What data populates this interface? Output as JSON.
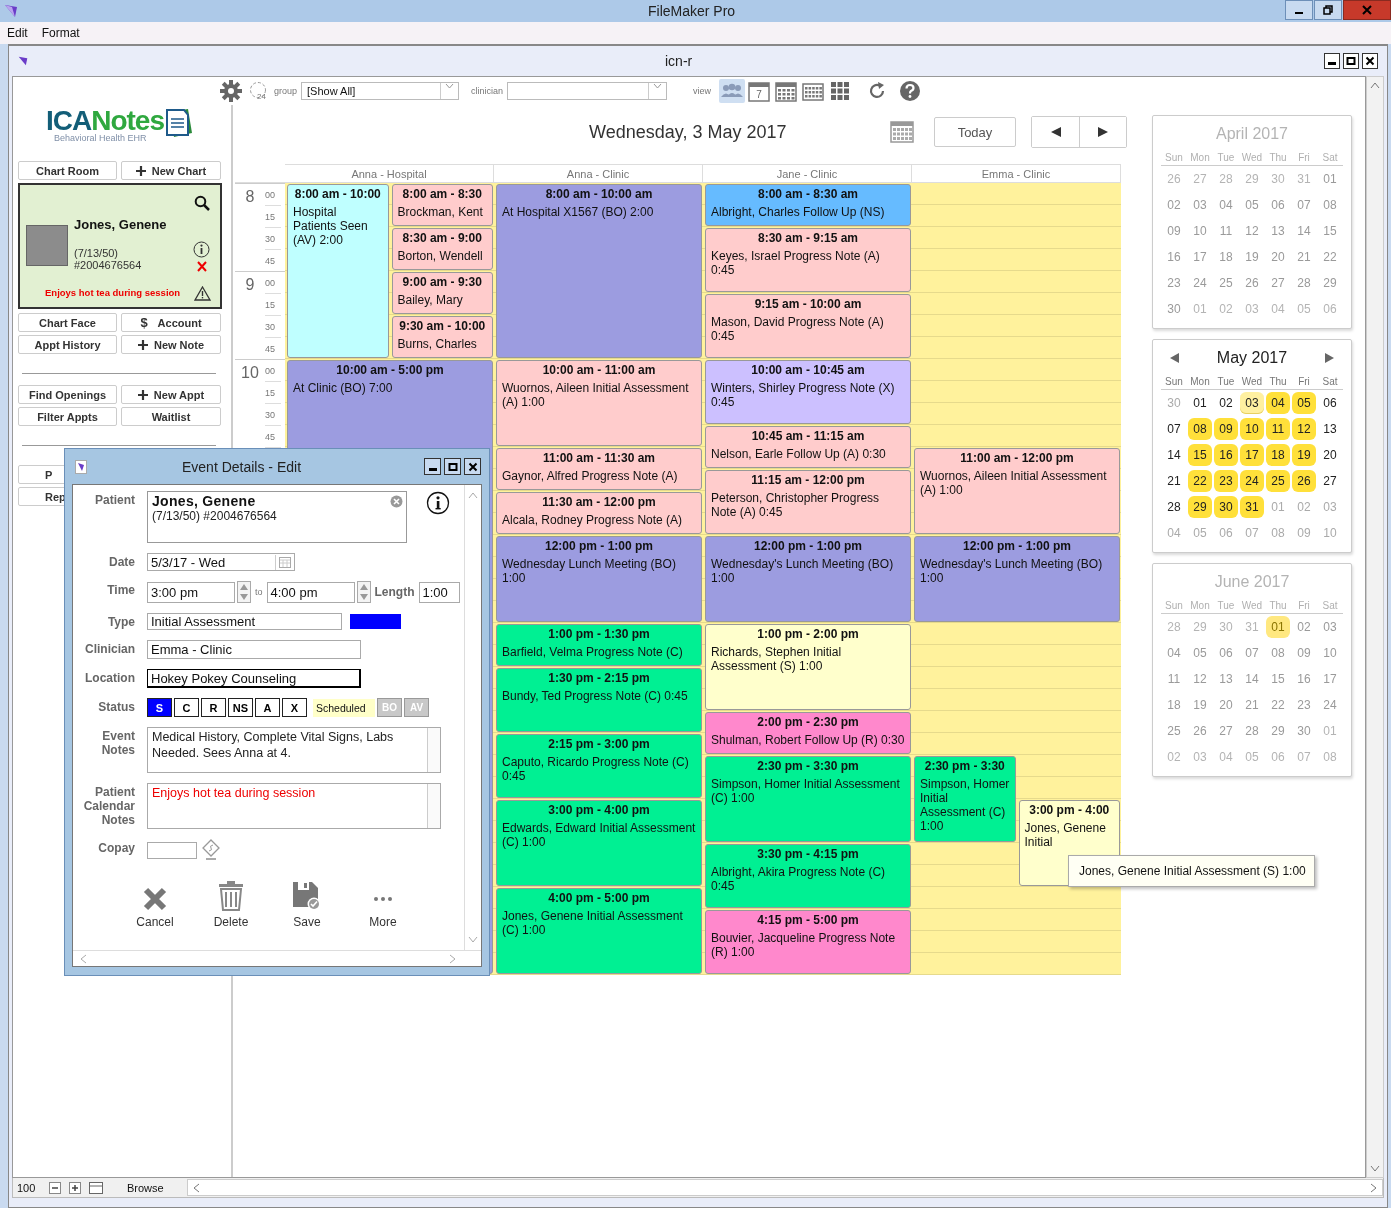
{
  "app_title": "FileMaker Pro",
  "menu": [
    "Edit",
    "Format"
  ],
  "window_title": "icn-r",
  "toolbar": {
    "history_label": "24",
    "group_label": "group",
    "group_value": "[Show All]",
    "clinician_label": "clinician",
    "view_label": "view",
    "views": [
      {
        "kind": "people",
        "selected": true
      },
      {
        "kind": "day",
        "label": "7",
        "selected": false
      },
      {
        "kind": "week",
        "selected": false
      },
      {
        "kind": "month",
        "selected": false
      },
      {
        "kind": "grid",
        "selected": false
      }
    ]
  },
  "sidebar": {
    "logo": {
      "part1": "ICA",
      "part2": "Notes",
      "tagline": "Behavioral Health EHR"
    },
    "top_buttons": [
      {
        "label": "Chart Room",
        "kind": "plain"
      },
      {
        "label": "New Chart",
        "kind": "add"
      }
    ],
    "patient": {
      "name": "Jones, Genene",
      "dob": "(7/13/50)",
      "number": "#2004676564",
      "note": "Enjoys hot tea during session"
    },
    "chart_buttons": [
      {
        "label": "Chart Face",
        "kind": "plain"
      },
      {
        "label": "Account",
        "kind": "money",
        "glyph": "$"
      },
      {
        "label": "Appt History",
        "kind": "plain"
      },
      {
        "label": "New Note",
        "kind": "add"
      }
    ],
    "appt_buttons": [
      {
        "label": "Find Openings",
        "kind": "plain"
      },
      {
        "label": "New Appt",
        "kind": "add"
      },
      {
        "label": "Filter Appts",
        "kind": "plain"
      },
      {
        "label": "Waitlist",
        "kind": "plain"
      }
    ],
    "other_buttons": [
      {
        "label": "P"
      },
      {
        "label": "Rep"
      }
    ]
  },
  "calendar": {
    "date_title": "Wednesday, 3 May 2017",
    "today": "Today",
    "hours": [
      {
        "hour": "8",
        "minutes": [
          "00",
          "15",
          "30",
          "45"
        ]
      },
      {
        "hour": "9",
        "minutes": [
          "00",
          "15",
          "30",
          "45"
        ]
      },
      {
        "hour": "10",
        "minutes": [
          "00",
          "15",
          "30",
          "45"
        ]
      }
    ],
    "columns": [
      {
        "header": "Anna - Hospital",
        "events": [
          {
            "time": "8:00 am - 10:00",
            "text": "Hospital Patients Seen (AV) 2:00",
            "color": "#bfffff"
          },
          {
            "time": "8:00 am - 8:30",
            "text": "Brockman, Kent",
            "color": "#ffcccc"
          },
          {
            "time": "8:30 am - 9:00",
            "text": "Borton, Wendell",
            "color": "#ffcccc"
          },
          {
            "time": "9:00 am - 9:30",
            "text": "Bailey, Mary",
            "color": "#ffcccc"
          },
          {
            "time": "9:30 am - 10:00",
            "text": "Burns, Charles",
            "color": "#ffcccc"
          },
          {
            "time": "10:00 am - 5:00 pm",
            "text": "At Clinic (BO) 7:00",
            "color": "#9c9ce0"
          }
        ]
      },
      {
        "header": "Anna - Clinic",
        "events": [
          {
            "time": "8:00 am - 10:00 am",
            "text": "At Hospital X1567 (BO) 2:00",
            "color": "#9c9ce0"
          },
          {
            "time": "10:00 am - 11:00 am",
            "text": "Wuornos, Aileen Initial Assessment (A) 1:00",
            "color": "#ffcccc"
          },
          {
            "time": "11:00 am - 11:30 am",
            "text": "Gaynor, Alfred Progress Note (A)",
            "color": "#ffcccc"
          },
          {
            "time": "11:30 am - 12:00 pm",
            "text": "Alcala, Rodney Progress Note (A)",
            "color": "#ffcccc"
          },
          {
            "time": "12:00 pm - 1:00 pm",
            "text": "Wednesday Lunch Meeting (BO) 1:00",
            "color": "#9c9ce0"
          },
          {
            "time": "1:00 pm - 1:30 pm",
            "text": "Barfield, Velma Progress Note (C)",
            "color": "#00f093"
          },
          {
            "time": "1:30 pm - 2:15 pm",
            "text": "Bundy, Ted Progress Note (C) 0:45",
            "color": "#00f093"
          },
          {
            "time": "2:15 pm - 3:00 pm",
            "text": "Caputo, Ricardo Progress Note (C) 0:45",
            "color": "#00f093"
          },
          {
            "time": "3:00 pm - 4:00 pm",
            "text": "Edwards, Edward Initial Assessment (C) 1:00",
            "color": "#00f093"
          },
          {
            "time": "4:00 pm - 5:00 pm",
            "text": "Jones, Genene Initial Assessment (C) 1:00",
            "color": "#00f093"
          }
        ]
      },
      {
        "header": "Jane - Clinic",
        "events": [
          {
            "time": "8:00 am - 8:30 am",
            "text": "Albright, Charles Follow Up (NS)",
            "color": "#66bbff"
          },
          {
            "time": "8:30 am - 9:15 am",
            "text": "Keyes, Israel Progress Note (A) 0:45",
            "color": "#ffcccc"
          },
          {
            "time": "9:15 am - 10:00 am",
            "text": "Mason, David Progress Note (A) 0:45",
            "color": "#ffcccc"
          },
          {
            "time": "10:00 am - 10:45 am",
            "text": "Winters, Shirley Progress Note (X) 0:45",
            "color": "#ccc0ff"
          },
          {
            "time": "10:45 am - 11:15 am",
            "text": "Nelson, Earle Follow Up (A) 0:30",
            "color": "#ffcccc"
          },
          {
            "time": "11:15 am - 12:00 pm",
            "text": "Peterson, Christopher Progress Note (A) 0:45",
            "color": "#ffcccc"
          },
          {
            "time": "12:00 pm - 1:00 pm",
            "text": "Wednesday's Lunch Meeting (BO) 1:00",
            "color": "#9c9ce0"
          },
          {
            "time": "1:00 pm - 2:00 pm",
            "text": "Richards, Stephen Initial Assessment (S) 1:00",
            "color": "#ffffcc"
          },
          {
            "time": "2:00 pm - 2:30 pm",
            "text": "Shulman, Robert Follow Up (R) 0:30",
            "color": "#ff88cc"
          },
          {
            "time": "2:30 pm - 3:30 pm",
            "text": "Simpson, Homer Initial Assessment (C) 1:00",
            "color": "#00f093"
          },
          {
            "time": "3:30 pm - 4:15 pm",
            "text": "Albright, Akira Progress Note (C) 0:45",
            "color": "#00f093"
          },
          {
            "time": "4:15 pm - 5:00 pm",
            "text": "Bouvier, Jacqueline Progress Note (R) 1:00",
            "color": "#ff88cc"
          }
        ]
      },
      {
        "header": "Emma - Clinic",
        "events": [
          {
            "time": "11:00 am - 12:00 pm",
            "text": "Wuornos, Aileen Initial Assessment (A) 1:00",
            "color": "#ffcccc"
          },
          {
            "time": "12:00 pm - 1:00 pm",
            "text": "Wednesday's Lunch Meeting (BO) 1:00",
            "color": "#9c9ce0"
          },
          {
            "time": "2:30 pm - 3:30",
            "text": "Simpson, Homer Initial Assessment (C) 1:00",
            "color": "#00f093"
          },
          {
            "time": "3:00 pm - 4:00",
            "text": "Jones, Genene Initial",
            "color": "#ffffcc"
          }
        ]
      }
    ]
  },
  "tooltip": "Jones, Genene Initial Assessment (S) 1:00",
  "minicals": [
    {
      "title": "April 2017",
      "active": false,
      "weekdays": [
        "Sun",
        "Mon",
        "Tue",
        "Wed",
        "Thu",
        "Fri",
        "Sat"
      ],
      "weeks": [
        [
          {
            "day": "26",
            "in_month": false,
            "booked": false,
            "selected": false
          },
          {
            "day": "27",
            "in_month": false,
            "booked": false,
            "selected": false
          },
          {
            "day": "28",
            "in_month": false,
            "booked": false,
            "selected": false
          },
          {
            "day": "29",
            "in_month": false,
            "booked": false,
            "selected": false
          },
          {
            "day": "30",
            "in_month": false,
            "booked": false,
            "selected": false
          },
          {
            "day": "31",
            "in_month": false,
            "booked": false,
            "selected": false
          },
          {
            "day": "01",
            "in_month": true,
            "booked": false,
            "selected": false
          }
        ],
        [
          {
            "day": "02",
            "in_month": true,
            "booked": false,
            "selected": false
          },
          {
            "day": "03",
            "in_month": true,
            "booked": false,
            "selected": false
          },
          {
            "day": "04",
            "in_month": true,
            "booked": false,
            "selected": false
          },
          {
            "day": "05",
            "in_month": true,
            "booked": false,
            "selected": false
          },
          {
            "day": "06",
            "in_month": true,
            "booked": false,
            "selected": false
          },
          {
            "day": "07",
            "in_month": true,
            "booked": false,
            "selected": false
          },
          {
            "day": "08",
            "in_month": true,
            "booked": false,
            "selected": false
          }
        ],
        [
          {
            "day": "09",
            "in_month": true,
            "booked": false,
            "selected": false
          },
          {
            "day": "10",
            "in_month": true,
            "booked": false,
            "selected": false
          },
          {
            "day": "11",
            "in_month": true,
            "booked": false,
            "selected": false
          },
          {
            "day": "12",
            "in_month": true,
            "booked": false,
            "selected": false
          },
          {
            "day": "13",
            "in_month": true,
            "booked": false,
            "selected": false
          },
          {
            "day": "14",
            "in_month": true,
            "booked": false,
            "selected": false
          },
          {
            "day": "15",
            "in_month": true,
            "booked": false,
            "selected": false
          }
        ],
        [
          {
            "day": "16",
            "in_month": true,
            "booked": false,
            "selected": false
          },
          {
            "day": "17",
            "in_month": true,
            "booked": false,
            "selected": false
          },
          {
            "day": "18",
            "in_month": true,
            "booked": false,
            "selected": false
          },
          {
            "day": "19",
            "in_month": true,
            "booked": false,
            "selected": false
          },
          {
            "day": "20",
            "in_month": true,
            "booked": false,
            "selected": false
          },
          {
            "day": "21",
            "in_month": true,
            "booked": false,
            "selected": false
          },
          {
            "day": "22",
            "in_month": true,
            "booked": false,
            "selected": false
          }
        ],
        [
          {
            "day": "23",
            "in_month": true,
            "booked": false,
            "selected": false
          },
          {
            "day": "24",
            "in_month": true,
            "booked": false,
            "selected": false
          },
          {
            "day": "25",
            "in_month": true,
            "booked": false,
            "selected": false
          },
          {
            "day": "26",
            "in_month": true,
            "booked": false,
            "selected": false
          },
          {
            "day": "27",
            "in_month": true,
            "booked": false,
            "selected": false
          },
          {
            "day": "28",
            "in_month": true,
            "booked": false,
            "selected": false
          },
          {
            "day": "29",
            "in_month": true,
            "booked": false,
            "selected": false
          }
        ],
        [
          {
            "day": "30",
            "in_month": true,
            "booked": false,
            "selected": false
          },
          {
            "day": "01",
            "in_month": false,
            "booked": false,
            "selected": false
          },
          {
            "day": "02",
            "in_month": false,
            "booked": false,
            "selected": false
          },
          {
            "day": "03",
            "in_month": false,
            "booked": false,
            "selected": false
          },
          {
            "day": "04",
            "in_month": false,
            "booked": false,
            "selected": false
          },
          {
            "day": "05",
            "in_month": false,
            "booked": false,
            "selected": false
          },
          {
            "day": "06",
            "in_month": false,
            "booked": false,
            "selected": false
          }
        ]
      ]
    },
    {
      "title": "May 2017",
      "active": true,
      "weekdays": [
        "Sun",
        "Mon",
        "Tue",
        "Wed",
        "Thu",
        "Fri",
        "Sat"
      ],
      "weeks": [
        [
          {
            "day": "30",
            "in_month": false,
            "booked": false,
            "selected": false
          },
          {
            "day": "01",
            "in_month": true,
            "booked": false,
            "selected": false
          },
          {
            "day": "02",
            "in_month": true,
            "booked": false,
            "selected": false
          },
          {
            "day": "03",
            "in_month": true,
            "booked": false,
            "selected": true
          },
          {
            "day": "04",
            "in_month": true,
            "booked": true,
            "selected": false
          },
          {
            "day": "05",
            "in_month": true,
            "booked": true,
            "selected": false
          },
          {
            "day": "06",
            "in_month": true,
            "booked": false,
            "selected": false
          }
        ],
        [
          {
            "day": "07",
            "in_month": true,
            "booked": false,
            "selected": false
          },
          {
            "day": "08",
            "in_month": true,
            "booked": true,
            "selected": false
          },
          {
            "day": "09",
            "in_month": true,
            "booked": true,
            "selected": false
          },
          {
            "day": "10",
            "in_month": true,
            "booked": true,
            "selected": false
          },
          {
            "day": "11",
            "in_month": true,
            "booked": true,
            "selected": false
          },
          {
            "day": "12",
            "in_month": true,
            "booked": true,
            "selected": false
          },
          {
            "day": "13",
            "in_month": true,
            "booked": false,
            "selected": false
          }
        ],
        [
          {
            "day": "14",
            "in_month": true,
            "booked": false,
            "selected": false
          },
          {
            "day": "15",
            "in_month": true,
            "booked": true,
            "selected": false
          },
          {
            "day": "16",
            "in_month": true,
            "booked": true,
            "selected": false
          },
          {
            "day": "17",
            "in_month": true,
            "booked": true,
            "selected": false
          },
          {
            "day": "18",
            "in_month": true,
            "booked": true,
            "selected": false
          },
          {
            "day": "19",
            "in_month": true,
            "booked": true,
            "selected": false
          },
          {
            "day": "20",
            "in_month": true,
            "booked": false,
            "selected": false
          }
        ],
        [
          {
            "day": "21",
            "in_month": true,
            "booked": false,
            "selected": false
          },
          {
            "day": "22",
            "in_month": true,
            "booked": true,
            "selected": false
          },
          {
            "day": "23",
            "in_month": true,
            "booked": true,
            "selected": false
          },
          {
            "day": "24",
            "in_month": true,
            "booked": true,
            "selected": false
          },
          {
            "day": "25",
            "in_month": true,
            "booked": true,
            "selected": false
          },
          {
            "day": "26",
            "in_month": true,
            "booked": true,
            "selected": false
          },
          {
            "day": "27",
            "in_month": true,
            "booked": false,
            "selected": false
          }
        ],
        [
          {
            "day": "28",
            "in_month": true,
            "booked": false,
            "selected": false
          },
          {
            "day": "29",
            "in_month": true,
            "booked": true,
            "selected": false
          },
          {
            "day": "30",
            "in_month": true,
            "booked": true,
            "selected": false
          },
          {
            "day": "31",
            "in_month": true,
            "booked": true,
            "selected": false
          },
          {
            "day": "01",
            "in_month": false,
            "booked": false,
            "selected": false
          },
          {
            "day": "02",
            "in_month": false,
            "booked": false,
            "selected": false
          },
          {
            "day": "03",
            "in_month": false,
            "booked": false,
            "selected": false
          }
        ],
        [
          {
            "day": "04",
            "in_month": false,
            "booked": false,
            "selected": false
          },
          {
            "day": "05",
            "in_month": false,
            "booked": false,
            "selected": false
          },
          {
            "day": "06",
            "in_month": false,
            "booked": false,
            "selected": false
          },
          {
            "day": "07",
            "in_month": false,
            "booked": false,
            "selected": false
          },
          {
            "day": "08",
            "in_month": false,
            "booked": false,
            "selected": false
          },
          {
            "day": "09",
            "in_month": false,
            "booked": false,
            "selected": false
          },
          {
            "day": "10",
            "in_month": false,
            "booked": false,
            "selected": false
          }
        ]
      ]
    },
    {
      "title": "June 2017",
      "active": false,
      "weekdays": [
        "Sun",
        "Mon",
        "Tue",
        "Wed",
        "Thu",
        "Fri",
        "Sat"
      ],
      "weeks": [
        [
          {
            "day": "28",
            "in_month": false,
            "booked": false,
            "selected": false
          },
          {
            "day": "29",
            "in_month": false,
            "booked": false,
            "selected": false
          },
          {
            "day": "30",
            "in_month": false,
            "booked": false,
            "selected": false
          },
          {
            "day": "31",
            "in_month": false,
            "booked": false,
            "selected": false
          },
          {
            "day": "01",
            "in_month": true,
            "booked": true,
            "selected": false
          },
          {
            "day": "02",
            "in_month": true,
            "booked": false,
            "selected": false
          },
          {
            "day": "03",
            "in_month": true,
            "booked": false,
            "selected": false
          }
        ],
        [
          {
            "day": "04",
            "in_month": true,
            "booked": false,
            "selected": false
          },
          {
            "day": "05",
            "in_month": true,
            "booked": false,
            "selected": false
          },
          {
            "day": "06",
            "in_month": true,
            "booked": false,
            "selected": false
          },
          {
            "day": "07",
            "in_month": true,
            "booked": false,
            "selected": false
          },
          {
            "day": "08",
            "in_month": true,
            "booked": false,
            "selected": false
          },
          {
            "day": "09",
            "in_month": true,
            "booked": false,
            "selected": false
          },
          {
            "day": "10",
            "in_month": true,
            "booked": false,
            "selected": false
          }
        ],
        [
          {
            "day": "11",
            "in_month": true,
            "booked": false,
            "selected": false
          },
          {
            "day": "12",
            "in_month": true,
            "booked": false,
            "selected": false
          },
          {
            "day": "13",
            "in_month": true,
            "booked": false,
            "selected": false
          },
          {
            "day": "14",
            "in_month": true,
            "booked": false,
            "selected": false
          },
          {
            "day": "15",
            "in_month": true,
            "booked": false,
            "selected": false
          },
          {
            "day": "16",
            "in_month": true,
            "booked": false,
            "selected": false
          },
          {
            "day": "17",
            "in_month": true,
            "booked": false,
            "selected": false
          }
        ],
        [
          {
            "day": "18",
            "in_month": true,
            "booked": false,
            "selected": false
          },
          {
            "day": "19",
            "in_month": true,
            "booked": false,
            "selected": false
          },
          {
            "day": "20",
            "in_month": true,
            "booked": false,
            "selected": false
          },
          {
            "day": "21",
            "in_month": true,
            "booked": false,
            "selected": false
          },
          {
            "day": "22",
            "in_month": true,
            "booked": false,
            "selected": false
          },
          {
            "day": "23",
            "in_month": true,
            "booked": false,
            "selected": false
          },
          {
            "day": "24",
            "in_month": true,
            "booked": false,
            "selected": false
          }
        ],
        [
          {
            "day": "25",
            "in_month": true,
            "booked": false,
            "selected": false
          },
          {
            "day": "26",
            "in_month": true,
            "booked": false,
            "selected": false
          },
          {
            "day": "27",
            "in_month": true,
            "booked": false,
            "selected": false
          },
          {
            "day": "28",
            "in_month": true,
            "booked": false,
            "selected": false
          },
          {
            "day": "29",
            "in_month": true,
            "booked": false,
            "selected": false
          },
          {
            "day": "30",
            "in_month": true,
            "booked": false,
            "selected": false
          },
          {
            "day": "01",
            "in_month": false,
            "booked": false,
            "selected": false
          }
        ],
        [
          {
            "day": "02",
            "in_month": false,
            "booked": false,
            "selected": false
          },
          {
            "day": "03",
            "in_month": false,
            "booked": false,
            "selected": false
          },
          {
            "day": "04",
            "in_month": false,
            "booked": false,
            "selected": false
          },
          {
            "day": "05",
            "in_month": false,
            "booked": false,
            "selected": false
          },
          {
            "day": "06",
            "in_month": false,
            "booked": false,
            "selected": false
          },
          {
            "day": "07",
            "in_month": false,
            "booked": false,
            "selected": false
          },
          {
            "day": "08",
            "in_month": false,
            "booked": false,
            "selected": false
          }
        ]
      ]
    }
  ],
  "dialog": {
    "title": "Event Details - Edit",
    "labels": {
      "patient": "Patient",
      "date": "Date",
      "time": "Time",
      "type": "Type",
      "clinician": "Clinician",
      "location": "Location",
      "status": "Status",
      "event_notes": "Event Notes",
      "calendar_notes": "Patient Calendar Notes",
      "copay": "Copay"
    },
    "patient_name": "Jones, Genene",
    "patient_info": "(7/13/50) #2004676564",
    "date": "5/3/17 - Wed",
    "time_from": "3:00 pm",
    "to_label": "to",
    "time_to": "4:00 pm",
    "length_label": "Length",
    "length": "1:00",
    "type": {
      "label": "Initial Assessment",
      "color": "#0000ff"
    },
    "clinician": "Emma - Clinic",
    "location": "Hokey Pokey Counseling",
    "statuses": [
      {
        "label": "S",
        "selected": true
      },
      {
        "label": "C",
        "selected": false
      },
      {
        "label": "R",
        "selected": false
      },
      {
        "label": "NS",
        "selected": false
      },
      {
        "label": "A",
        "selected": false
      },
      {
        "label": "X",
        "selected": false
      }
    ],
    "status_text": "Scheduled",
    "flags": [
      {
        "label": "BO",
        "on": false
      },
      {
        "label": "AV",
        "on": false
      }
    ],
    "event_notes": "Medical History, Complete Vital Signs, Labs Needed. Sees Anna at 4.",
    "calendar_notes": "Enjoys hot tea during session",
    "actions": [
      {
        "kind": "cancel",
        "label": "Cancel"
      },
      {
        "kind": "delete",
        "label": "Delete"
      },
      {
        "kind": "save",
        "label": "Save"
      },
      {
        "kind": "more",
        "label": "More"
      }
    ]
  },
  "status_bar": {
    "zoom": "100",
    "mode": "Browse"
  }
}
